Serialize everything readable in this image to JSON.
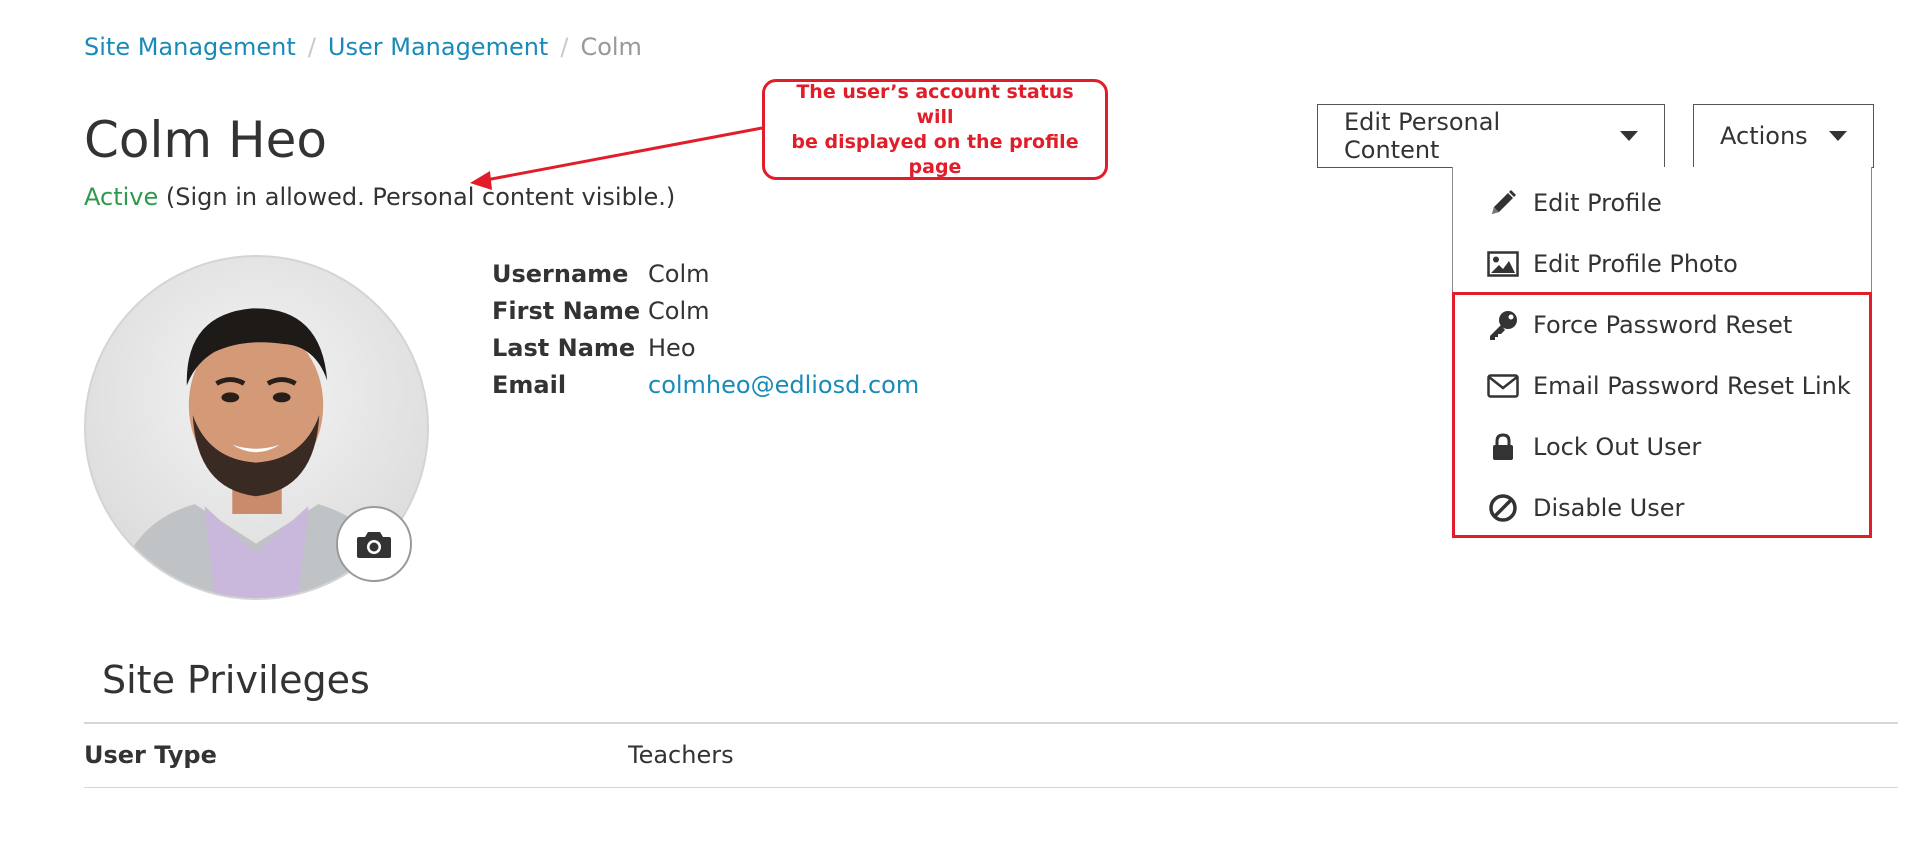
{
  "breadcrumb": {
    "items": [
      "Site Management",
      "User Management"
    ],
    "current": "Colm",
    "separator": "/"
  },
  "profile": {
    "name": "Colm Heo",
    "status": "Active",
    "status_detail": "(Sign in allowed. Personal content visible.)",
    "details": [
      {
        "label": "Username",
        "value": "Colm"
      },
      {
        "label": "First Name",
        "value": "Colm"
      },
      {
        "label": "Last Name",
        "value": "Heo"
      },
      {
        "label": "Email",
        "value": "colmheo@edliosd.com"
      }
    ]
  },
  "callout": {
    "line1": "The user’s account status will",
    "line2": "be displayed on the profile page"
  },
  "buttons": {
    "edit_personal_content": "Edit Personal Content",
    "actions": "Actions"
  },
  "actions_menu": [
    {
      "label": "Edit Profile",
      "icon": "pencil-icon"
    },
    {
      "label": "Edit Profile Photo",
      "icon": "image-icon"
    },
    {
      "label": "Force Password Reset",
      "icon": "key-icon"
    },
    {
      "label": "Email Password Reset Link",
      "icon": "envelope-icon"
    },
    {
      "label": "Lock Out User",
      "icon": "lock-icon"
    },
    {
      "label": "Disable User",
      "icon": "ban-icon"
    }
  ],
  "site_privileges": {
    "title": "Site Privileges",
    "rows": [
      {
        "label": "User Type",
        "value": "Teachers"
      }
    ]
  },
  "colors": {
    "link": "#1a8bb8",
    "active": "#2e9a4e",
    "annotation": "#e11d2a",
    "text": "#333333"
  }
}
